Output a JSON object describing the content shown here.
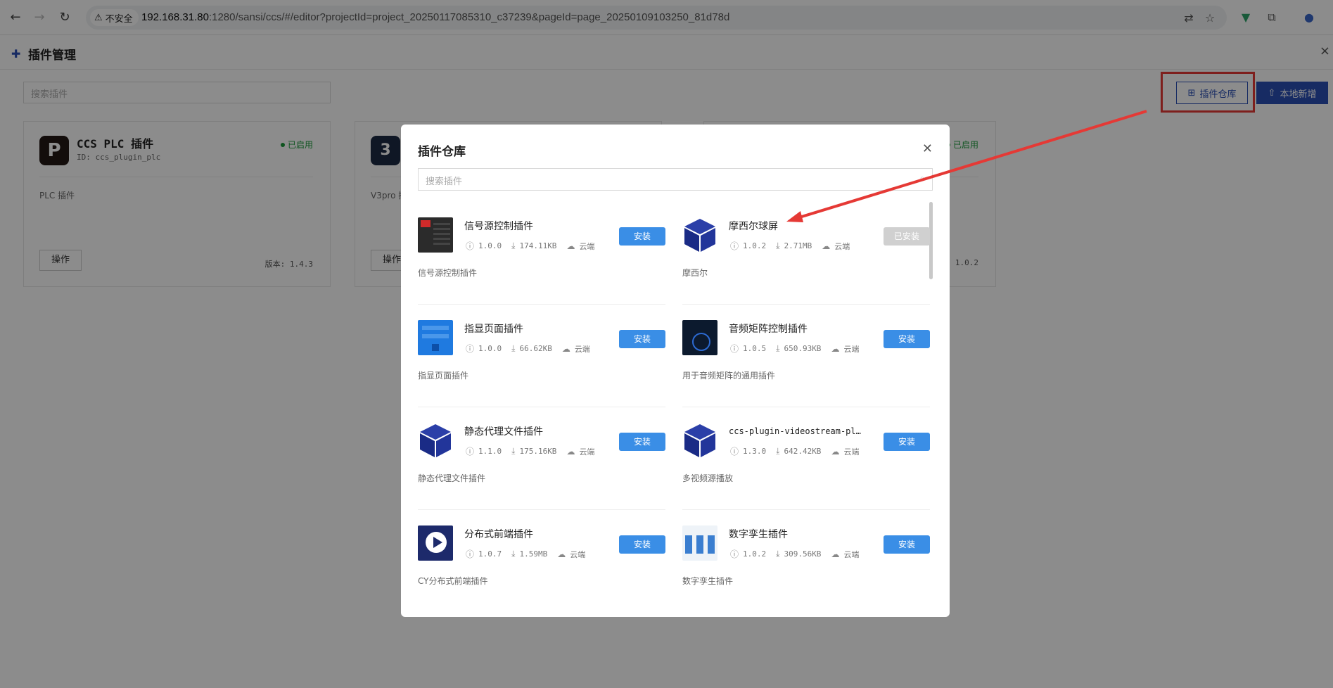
{
  "browser": {
    "insecure_label": "不安全",
    "url_host": "192.168.31.80",
    "url_rest": ":1280/sansi/ccs/#/editor?projectId=project_20250117085310_c37239&pageId=page_20250109103250_81d78d"
  },
  "app": {
    "title": "插件管理",
    "search_placeholder": "搜索插件",
    "repo_button": "插件仓库",
    "local_button": "本地新增",
    "cards": [
      {
        "name": "CCS PLC 插件",
        "id_text": "ID: ccs_plugin_plc",
        "status": "已启用",
        "desc": "PLC 插件",
        "op_label": "操作",
        "version": "版本: 1.4.3"
      },
      {
        "desc": "V3pro 插",
        "op_label": "操作"
      },
      {
        "status": "已启用",
        "version": ": 1.0.2"
      }
    ]
  },
  "modal": {
    "title": "插件仓库",
    "search_placeholder": "搜索插件",
    "plugins": [
      {
        "name": "信号源控制插件",
        "version": "1.0.0",
        "size": "174.11KB",
        "source": "云端",
        "desc": "信号源控制插件",
        "action": "安装",
        "installed": false
      },
      {
        "name": "摩西尔球屏",
        "version": "1.0.2",
        "size": "2.71MB",
        "source": "云端",
        "desc": "摩西尔",
        "action": "已安装",
        "installed": true
      },
      {
        "name": "指显页面插件",
        "version": "1.0.0",
        "size": "66.62KB",
        "source": "云端",
        "desc": "指显页面插件",
        "action": "安装",
        "installed": false
      },
      {
        "name": "音频矩阵控制插件",
        "version": "1.0.5",
        "size": "650.93KB",
        "source": "云端",
        "desc": "用于音频矩阵的通用插件",
        "action": "安装",
        "installed": false
      },
      {
        "name": "静态代理文件插件",
        "version": "1.1.0",
        "size": "175.16KB",
        "source": "云端",
        "desc": "静态代理文件插件",
        "action": "安装",
        "installed": false
      },
      {
        "name": "ccs-plugin-videostream-pla…",
        "version": "1.3.0",
        "size": "642.42KB",
        "source": "云端",
        "desc": "多视频源播放",
        "action": "安装",
        "installed": false
      },
      {
        "name": "分布式前端插件",
        "version": "1.0.7",
        "size": "1.59MB",
        "source": "云端",
        "desc": "CY分布式前端插件",
        "action": "安装",
        "installed": false
      },
      {
        "name": "数字孪生插件",
        "version": "1.0.2",
        "size": "309.56KB",
        "source": "云端",
        "desc": "数字孪生插件",
        "action": "安装",
        "installed": false
      }
    ]
  },
  "colors": {
    "accent": "#2a4fb5",
    "install_button": "#3a8ee6",
    "installed_button": "#d0d0d0",
    "status_green": "#1a9a3a",
    "annotation_red": "#e53935"
  }
}
